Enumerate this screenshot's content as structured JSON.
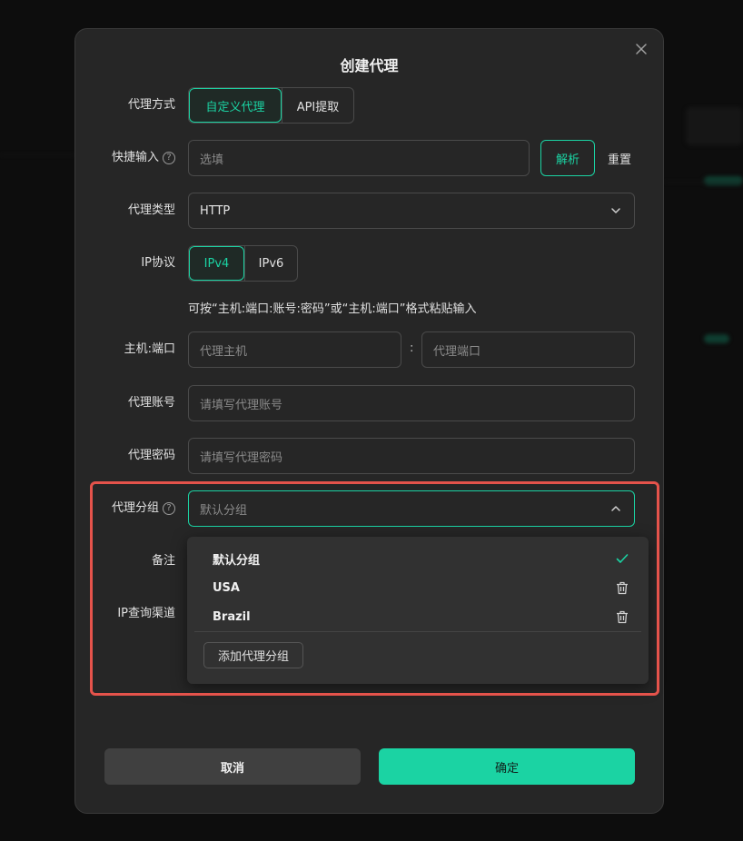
{
  "modal": {
    "title": "创建代理",
    "fields": {
      "proxy_mode": {
        "label": "代理方式",
        "options": [
          "自定义代理",
          "API提取"
        ],
        "selected": "自定义代理"
      },
      "quick_input": {
        "label": "快捷输入",
        "placeholder": "选填",
        "parse_label": "解析",
        "reset_label": "重置"
      },
      "proxy_type": {
        "label": "代理类型",
        "value": "HTTP"
      },
      "ip_protocol": {
        "label": "IP协议",
        "options": [
          "IPv4",
          "IPv6"
        ],
        "selected": "IPv4"
      },
      "hint": "可按“主机:端口:账号:密码”或“主机:端口”格式粘贴输入",
      "host_port": {
        "label": "主机:端口",
        "host_placeholder": "代理主机",
        "separator": ":",
        "port_placeholder": "代理端口"
      },
      "account": {
        "label": "代理账号",
        "placeholder": "请填写代理账号"
      },
      "password": {
        "label": "代理密码",
        "placeholder": "请填写代理密码"
      },
      "group": {
        "label": "代理分组",
        "value": "默认分组",
        "dropdown": {
          "items": [
            {
              "label": "默认分组",
              "icon": "check-icon"
            },
            {
              "label": "USA",
              "icon": "trash-icon"
            },
            {
              "label": "Brazil",
              "icon": "trash-icon"
            }
          ],
          "add_label": "添加代理分组"
        }
      },
      "remark": {
        "label": "备注"
      },
      "ip_channel": {
        "label": "IP查询渠道"
      }
    },
    "footer": {
      "cancel_label": "取消",
      "confirm_label": "确定"
    }
  },
  "colors": {
    "accent": "#1bd3a3",
    "highlight": "#e5534b",
    "modal_bg": "#262626"
  }
}
